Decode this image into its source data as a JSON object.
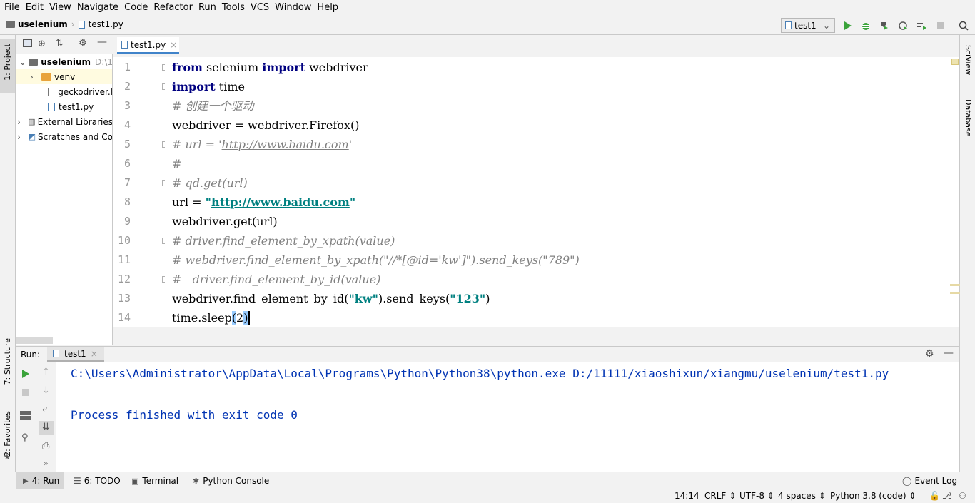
{
  "menu": [
    "File",
    "Edit",
    "View",
    "Navigate",
    "Code",
    "Refactor",
    "Run",
    "Tools",
    "VCS",
    "Window",
    "Help"
  ],
  "breadcrumb": {
    "project": "uselenium",
    "file": "test1.py"
  },
  "toolbar": {
    "run_config": "test1"
  },
  "left_strip": {
    "project": "1: Project",
    "structure": "7: Structure",
    "favorites": "2: Favorites"
  },
  "right_strip": {
    "sciview": "SciView",
    "database": "Database"
  },
  "project_tree": {
    "root": "uselenium",
    "root_path": "D:\\1",
    "items": [
      "venv",
      "geckodriver.l",
      "test1.py",
      "External Libraries",
      "Scratches and Co"
    ]
  },
  "editor": {
    "tab": "test1.py",
    "line_numbers": [
      "1",
      "2",
      "3",
      "4",
      "5",
      "6",
      "7",
      "8",
      "9",
      "10",
      "11",
      "12",
      "13",
      "14"
    ]
  },
  "run_panel": {
    "label": "Run:",
    "tab": "test1",
    "lines": [
      "C:\\Users\\Administrator\\AppData\\Local\\Programs\\Python\\Python38\\python.exe D:/11111/xiaoshixun/xiangmu/uselenium/test1.py",
      "",
      "Process finished with exit code 0"
    ]
  },
  "bottom_tabs": {
    "run": "4: Run",
    "todo": "6: TODO",
    "terminal": "Terminal",
    "python_console": "Python Console",
    "event_log": "Event Log"
  },
  "status": {
    "position": "14:14",
    "line_sep": "CRLF",
    "encoding": "UTF-8",
    "indent": "4 spaces",
    "interpreter": "Python 3.8 (code)"
  },
  "colors": {
    "keyword": "#000080",
    "string": "#008080",
    "comment": "#808080",
    "console": "#0033b3",
    "caret_line": "#fffae3",
    "run_green": "#3aa33a"
  }
}
